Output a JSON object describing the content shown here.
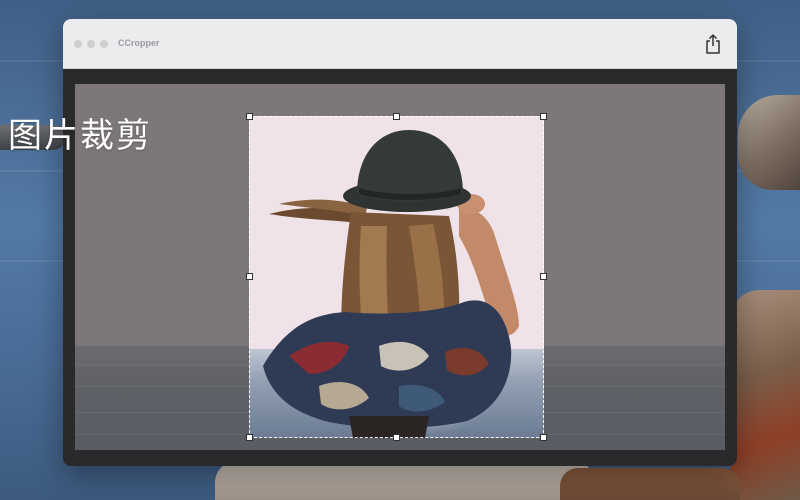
{
  "app": {
    "title": "CCropper"
  },
  "overlay": {
    "caption": "图片裁剪"
  },
  "toolbar": {
    "share_icon": "share-icon"
  },
  "colors": {
    "window_frame": "#2a2a2c",
    "titlebar": "#ececee",
    "canvas_dim": "#7d777b",
    "crop_border": "#ffffff"
  }
}
